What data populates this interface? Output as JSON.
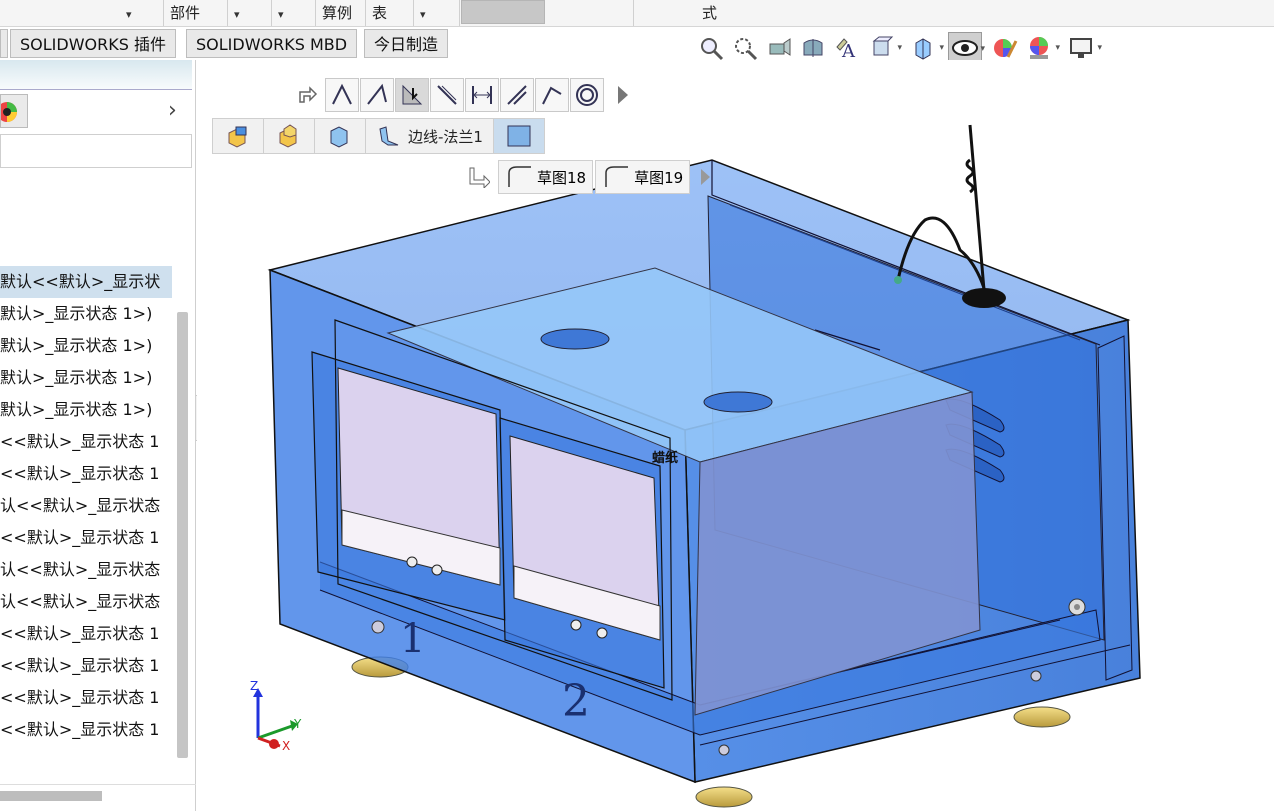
{
  "menubar": {
    "part_label": "部件",
    "example_label": "算例",
    "table_label": "表",
    "style_label": "式"
  },
  "tabs": [
    {
      "label": "SOLIDWORKS 插件"
    },
    {
      "label": "SOLIDWORKS MBD"
    },
    {
      "label": "今日制造"
    }
  ],
  "view_icons": [
    "zoom-fit-icon",
    "zoom-area-icon",
    "previous-view-icon",
    "section-view-icon",
    "dynamic-annotation-icon",
    "view-orientation-icon",
    "display-style-icon",
    "hide-show-icon",
    "edit-appearance-icon",
    "apply-scene-icon",
    "view-settings-icon"
  ],
  "feature_tree": {
    "items": [
      {
        "label": "默认<<默认>_显示状",
        "selected": true
      },
      {
        "label": "默认>_显示状态 1>)"
      },
      {
        "label": "默认>_显示状态 1>)"
      },
      {
        "label": "默认>_显示状态 1>)"
      },
      {
        "label": "默认>_显示状态 1>)"
      },
      {
        "label": "<<默认>_显示状态 1"
      },
      {
        "label": "<<默认>_显示状态 1"
      },
      {
        "label": "认<<默认>_显示状态"
      },
      {
        "label": "<<默认>_显示状态 1"
      },
      {
        "label": "认<<默认>_显示状态"
      },
      {
        "label": "认<<默认>_显示状态"
      },
      {
        "label": "<<默认>_显示状态 1"
      },
      {
        "label": "<<默认>_显示状态 1"
      },
      {
        "label": "<<默认>_显示状态 1"
      },
      {
        "label": "<<默认>_显示状态 1"
      }
    ]
  },
  "breadcrumb": {
    "edge_flange": "边线-法兰1"
  },
  "sketches": [
    {
      "label": "草图18"
    },
    {
      "label": "草图19"
    }
  ],
  "model_labels": {
    "bay1": "1",
    "bay2": "2"
  },
  "triad": {
    "z": "Z",
    "y": "Y",
    "x": "X"
  },
  "colors": {
    "housing": "#3d7fe0",
    "accent": "#1e5fc0"
  }
}
